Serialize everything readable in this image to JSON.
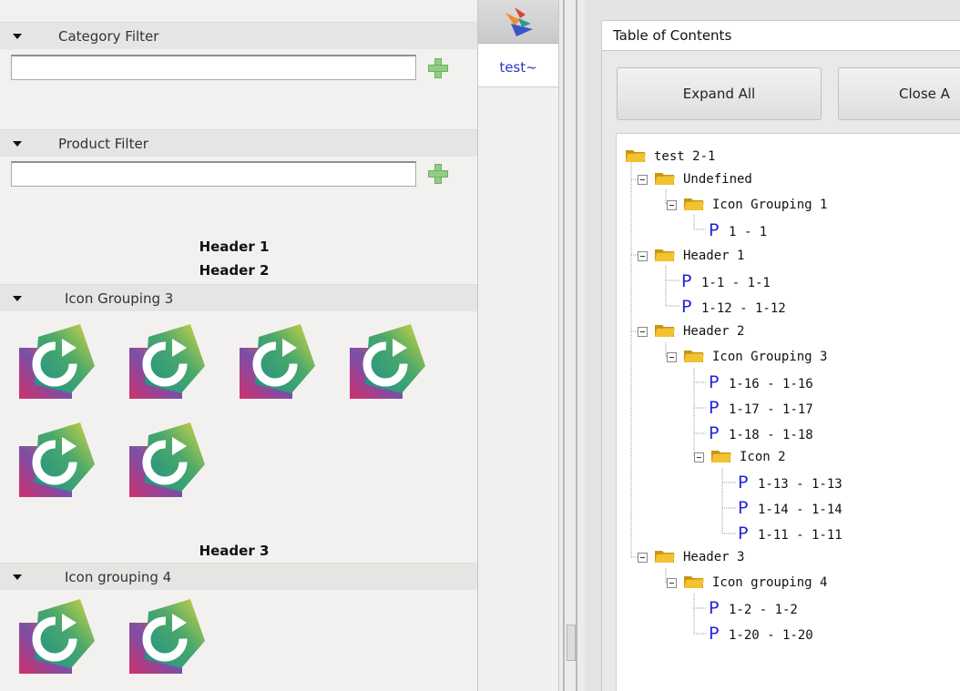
{
  "left_panel": {
    "category_filter": {
      "title": "Category Filter",
      "value": ""
    },
    "product_filter": {
      "title": "Product Filter",
      "value": ""
    },
    "headers": [
      "Header 1",
      "Header 2",
      "Header 3"
    ],
    "groups": [
      {
        "title": "Icon Grouping 3",
        "icon_count": 6
      },
      {
        "title": "Icon grouping 4",
        "icon_count": 2
      }
    ],
    "app_icon": "refresh-app-icon"
  },
  "tabs": [
    {
      "icon": "bird-logo-icon"
    },
    {
      "label": "test~",
      "selected": true
    }
  ],
  "toc": {
    "title": "Table of Contents",
    "expand_all_label": "Expand All",
    "close_all_label": "Close A",
    "tree": {
      "root": "test 2-1",
      "undefined": "Undefined",
      "icon_grouping_1": "Icon Grouping 1",
      "n_1_1": "1 - 1",
      "header_1": "Header 1",
      "n_1_1b": "1-1 - 1-1",
      "n_1_12": "1-12 - 1-12",
      "header_2": "Header 2",
      "icon_grouping_3": "Icon Grouping 3",
      "n_1_16": "1-16 - 1-16",
      "n_1_17": "1-17 - 1-17",
      "n_1_18": "1-18 - 1-18",
      "icon_2": "Icon 2",
      "n_1_13": "1-13 - 1-13",
      "n_1_14": "1-14 - 1-14",
      "n_1_11": "1-11 - 1-11",
      "header_3": "Header 3",
      "icon_grouping_4": "Icon grouping 4",
      "n_1_2": "1-2 - 1-2",
      "n_1_20": "1-20 - 1-20"
    },
    "product_marker": "P"
  },
  "colors": {
    "accent_blue": "#2222dd",
    "tab_text": "#2b38c8",
    "folder_yellow": "#e8b31a",
    "plus_green": "#8fce83"
  }
}
